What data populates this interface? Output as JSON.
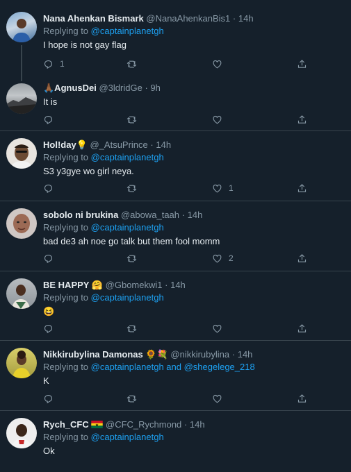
{
  "replying_prefix": "Replying to",
  "tweets": [
    {
      "name": "Nana Ahenkan Bismark",
      "handle": "@NanaAhenkanBis1",
      "time": "14h",
      "replying_to": "@captainplanetgh",
      "text": "I hope is not gay flag",
      "reply_count": "1",
      "retweet_count": "",
      "like_count": ""
    },
    {
      "name": "🙏🏾AgnusDei",
      "handle": "@3ldridGe",
      "time": "9h",
      "text": "It is",
      "reply_count": "",
      "retweet_count": "",
      "like_count": ""
    },
    {
      "name": "Hol!day💡",
      "handle": "@_AtsuPrince",
      "time": "14h",
      "replying_to": "@captainplanetgh",
      "text": "S3 y3gye wo girl neya.",
      "reply_count": "",
      "retweet_count": "",
      "like_count": "1"
    },
    {
      "name": "sobolo ni brukina",
      "handle": "@abowa_taah",
      "time": "14h",
      "replying_to": "@captainplanetgh",
      "text": "bad de3 ah noe go talk but them fool momm",
      "reply_count": "",
      "retweet_count": "",
      "like_count": "2"
    },
    {
      "name": "BE HAPPY 🤗",
      "handle": "@Gbomekwi1",
      "time": "14h",
      "replying_to": "@captainplanetgh",
      "text": "😆",
      "reply_count": "",
      "retweet_count": "",
      "like_count": ""
    },
    {
      "name": "Nikkirubylina Damonas 🌻💐",
      "handle": "@nikkirubylina",
      "time": "14h",
      "replying_to": "@captainplanetgh and @shegelege_218",
      "text": "K",
      "reply_count": "",
      "retweet_count": "",
      "like_count": ""
    },
    {
      "name": "Rych_CFC",
      "handle": "@CFC_Rychmond",
      "time": "14h",
      "replying_to": "@captainplanetgh",
      "text": "Ok",
      "reply_count": "",
      "retweet_count": "",
      "like_count": ""
    }
  ],
  "colors": {
    "background": "#15202b",
    "accent": "#1da1f2",
    "muted": "#8899a6",
    "border": "#38444d"
  },
  "icons": [
    "reply-icon",
    "retweet-icon",
    "like-icon",
    "share-icon",
    "ghana-flag-icon"
  ]
}
